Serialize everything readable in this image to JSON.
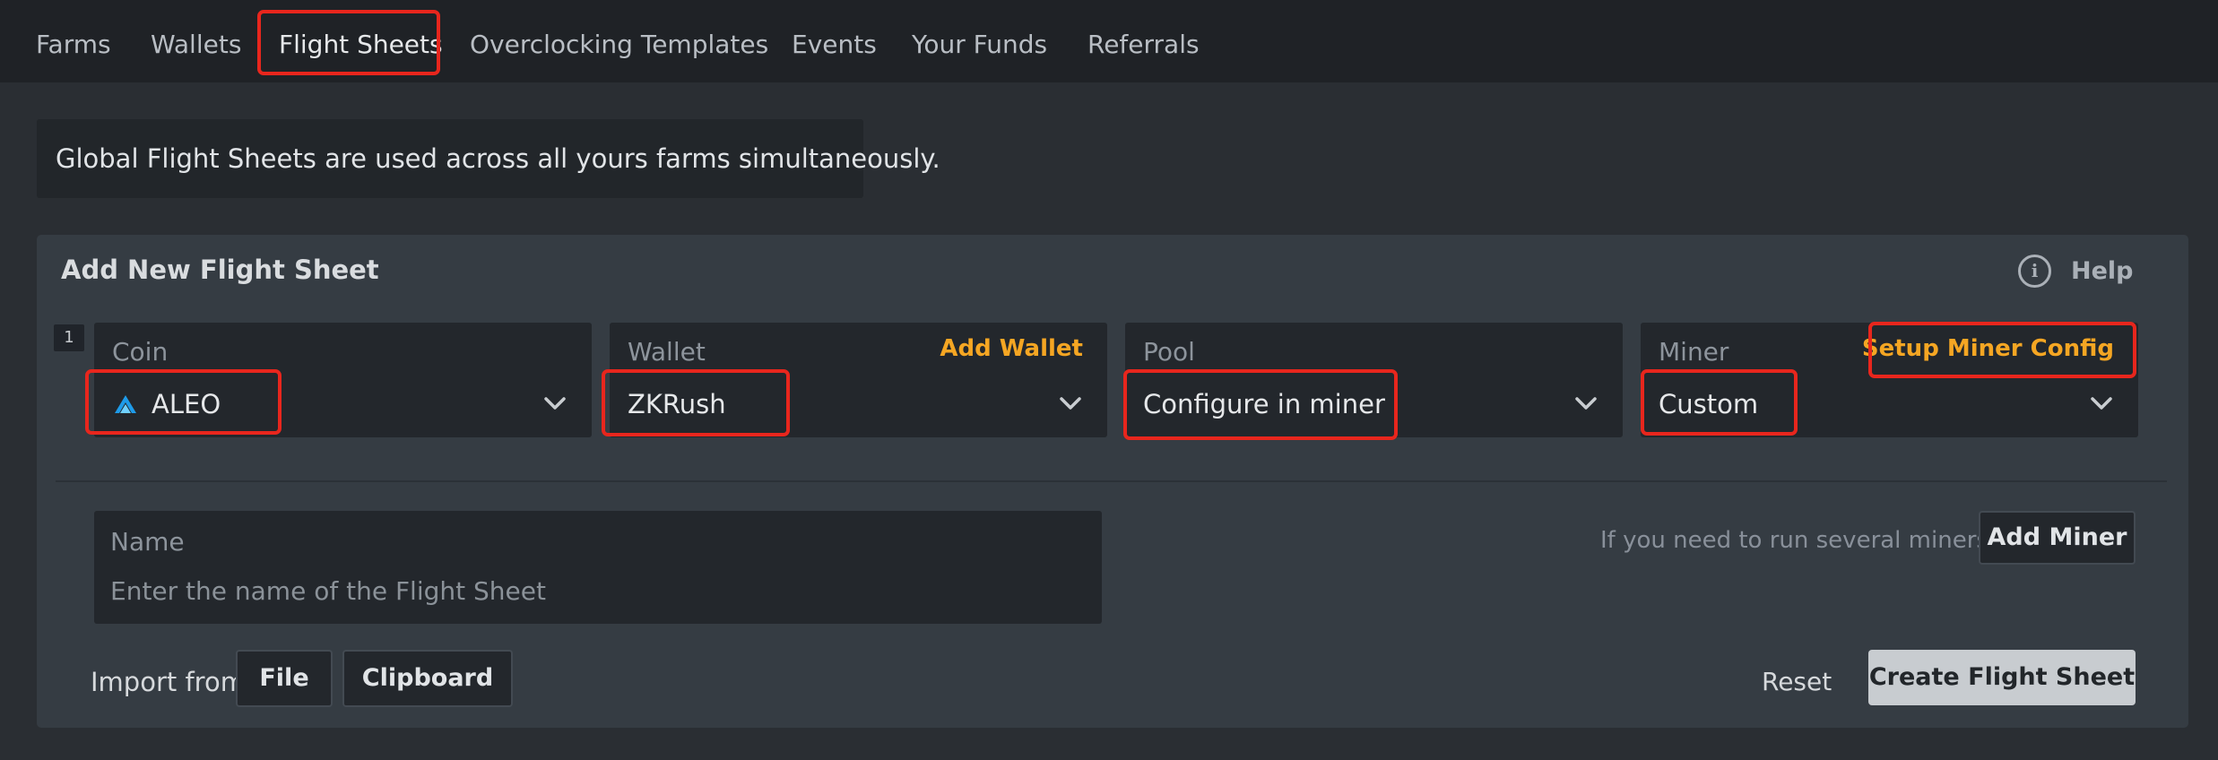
{
  "nav": {
    "items": [
      {
        "label": "Farms"
      },
      {
        "label": "Wallets"
      },
      {
        "label": "Flight Sheets"
      },
      {
        "label": "Overclocking Templates"
      },
      {
        "label": "Events"
      },
      {
        "label": "Your Funds"
      },
      {
        "label": "Referrals"
      }
    ],
    "active": "Flight Sheets"
  },
  "banner": {
    "text": "Global Flight Sheets are used across all yours farms simultaneously."
  },
  "panel": {
    "title": "Add New Flight Sheet",
    "help_label": "Help",
    "help_icon_glyph": "i",
    "row_number": "1",
    "coin": {
      "label": "Coin",
      "value": "ALEO",
      "icon": "aleo-logo-icon"
    },
    "wallet": {
      "label": "Wallet",
      "value": "ZKRush",
      "link": "Add Wallet"
    },
    "pool": {
      "label": "Pool",
      "value": "Configure in miner"
    },
    "miner": {
      "label": "Miner",
      "value": "Custom",
      "link": "Setup Miner Config"
    },
    "name": {
      "label": "Name",
      "placeholder": "Enter the name of the Flight Sheet"
    },
    "add_miner_hint": "If you need to run several miners",
    "add_miner_button": "Add Miner",
    "import_label": "Import from",
    "file_button": "File",
    "clipboard_button": "Clipboard",
    "reset_button": "Reset",
    "create_button": "Create Flight Sheet"
  },
  "colors": {
    "accent": "#f5a623",
    "highlight": "#e8261d",
    "background": "#2a2e33",
    "panel": "#353c43"
  }
}
